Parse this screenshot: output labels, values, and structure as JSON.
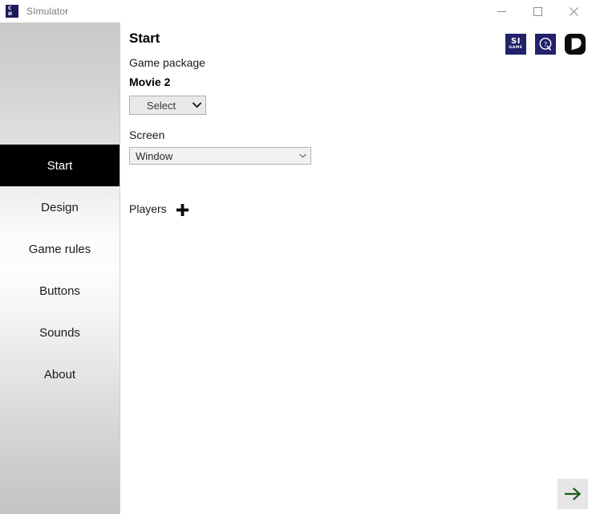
{
  "window": {
    "title": "SImulator",
    "icon_name": "sigame-app-icon",
    "icon_line1": "C",
    "icon_line2": "И",
    "controls": {
      "minimize": "minimize",
      "maximize": "maximize",
      "close": "close"
    }
  },
  "sidebar": {
    "items": [
      {
        "label": "Start",
        "active": true
      },
      {
        "label": "Design",
        "active": false
      },
      {
        "label": "Game rules",
        "active": false
      },
      {
        "label": "Buttons",
        "active": false
      },
      {
        "label": "Sounds",
        "active": false
      },
      {
        "label": "About",
        "active": false
      }
    ]
  },
  "main": {
    "page_title": "Start",
    "package": {
      "label": "Game package",
      "value": "Movie 2",
      "select_button": "Select",
      "caret_icon": "chevron-down-icon"
    },
    "screen": {
      "label": "Screen",
      "selected": "Window",
      "caret_icon": "chevron-down-icon"
    },
    "players": {
      "label": "Players",
      "add_icon": "plus-icon"
    },
    "next_button": {
      "icon": "arrow-right-icon",
      "color": "#1a5c1a"
    }
  },
  "brand_icons": [
    {
      "name": "sigame-logo",
      "line1": "SI",
      "line2": "GAME",
      "color": "#22226b"
    },
    {
      "name": "quiz-q-logo",
      "letter": "Q",
      "color": "#22226b"
    },
    {
      "name": "patreon-logo",
      "color": "#0c0c0c"
    }
  ],
  "colors": {
    "accent_navy": "#22226b",
    "active_nav_bg": "#000000",
    "next_arrow_green": "#1a5c1a",
    "content_bg": "#ffffff"
  }
}
